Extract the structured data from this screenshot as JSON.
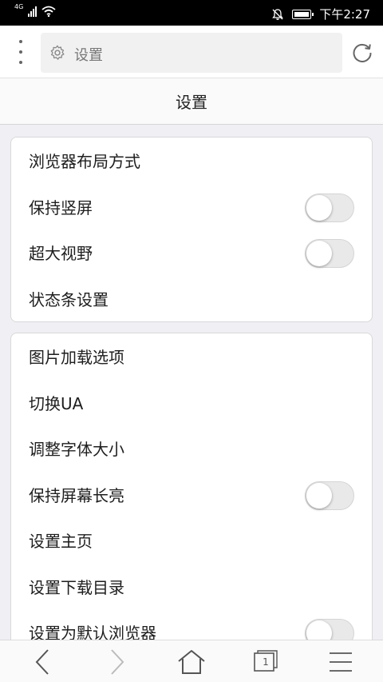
{
  "status_bar": {
    "network": "4G",
    "time": "下午2:27",
    "icons": [
      "signal-icon",
      "wifi-icon",
      "silent-bell-icon",
      "battery-icon"
    ]
  },
  "toolbar": {
    "menu_icon": "more-vertical-icon",
    "url_icon": "gear-icon",
    "url_text": "设置",
    "refresh_icon": "refresh-icon"
  },
  "page": {
    "title": "设置"
  },
  "card1": {
    "items": [
      {
        "label": "浏览器布局方式"
      },
      {
        "label": "保持竖屏",
        "toggle": false
      },
      {
        "label": "超大视野",
        "toggle": false
      },
      {
        "label": "状态条设置"
      }
    ]
  },
  "card2": {
    "items": [
      {
        "label": "图片加载选项"
      },
      {
        "label": "切换UA"
      },
      {
        "label": "调整字体大小"
      },
      {
        "label": "保持屏幕长亮",
        "toggle": false
      },
      {
        "label": "设置主页"
      },
      {
        "label": "设置下载目录"
      },
      {
        "label": "设置为默认浏览器",
        "toggle": false
      }
    ]
  },
  "bottom_nav": {
    "back_icon": "back-arrow-icon",
    "forward_icon": "forward-arrow-icon",
    "home_icon": "home-icon",
    "tabs_icon": "tabs-icon",
    "tab_count": "1",
    "menu_icon": "hamburger-menu-icon"
  },
  "colors": {
    "background": "#efeff4",
    "toggle_off": "#e9e9e9",
    "status_bar": "#000000"
  }
}
